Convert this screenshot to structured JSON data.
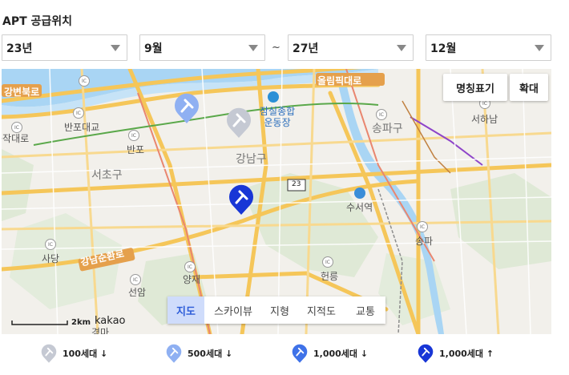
{
  "title": "APT 공급위치",
  "filters": {
    "start_year": "23년",
    "start_month": "9월",
    "separator": "~",
    "end_year": "27년",
    "end_month": "12월"
  },
  "map_controls": {
    "label_toggle": "명칭표기",
    "zoom": "확대"
  },
  "map_types": [
    "지도",
    "스카이뷰",
    "지형",
    "지적도",
    "교통"
  ],
  "active_map_type": "지도",
  "scale": {
    "distance": "2km",
    "brand": "kakao"
  },
  "place_labels": {
    "road1": "강변북로",
    "road2": "올림픽대로",
    "stadium1": "잠실종합",
    "stadium2": "운동장",
    "banpo_bridge": "반포대교",
    "banpo": "반포",
    "gangnam": "강남구",
    "seocho": "서초구",
    "songpa": "송파구",
    "suseo": "수서역",
    "seohanam": "서하남",
    "songpa2": "송파",
    "hwy23": "23",
    "gangnam_sunhwan": "강남순환로",
    "sadang": "사당",
    "yangjae": "양재",
    "seonam": "선암",
    "heolleung": "헌릉",
    "gyeongma": "경마",
    "dongjakdaero": "동작대로"
  },
  "legend": [
    {
      "label": "100세대 ↓",
      "color": "#c5c9d3"
    },
    {
      "label": "500세대 ↓",
      "color": "#8fb0f2"
    },
    {
      "label": "1,000세대 ↓",
      "color": "#3f72e8"
    },
    {
      "label": "1,000세대 ↑",
      "color": "#1836d6"
    }
  ],
  "markers": [
    {
      "tier": "500세대 ↓",
      "color": "#8fb0f2"
    },
    {
      "tier": "100세대 ↓",
      "color": "#c5c9d3"
    },
    {
      "tier": "1,000세대 ↑",
      "color": "#1836d6"
    }
  ],
  "colors": {
    "river": "#a6d3f3",
    "park": "#d8e6cf",
    "major_road": "#f6c453",
    "red_road": "#e9866f"
  }
}
